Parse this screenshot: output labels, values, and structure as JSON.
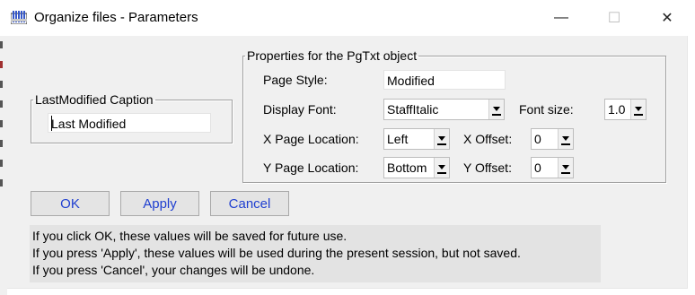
{
  "window": {
    "title": "Organize files - Parameters",
    "min_glyph": "—",
    "max_glyph": "☐",
    "close_glyph": "✕"
  },
  "caption_group": {
    "legend": "LastModified Caption",
    "value": "Last Modified"
  },
  "props_group": {
    "legend": "Properties for the PgTxt object",
    "page_style_label": "Page Style:",
    "page_style_value": "Modified",
    "display_font_label": "Display Font:",
    "display_font_value": "StaffItalic",
    "font_size_label": "Font size:",
    "font_size_value": "1.0",
    "x_loc_label": "X Page Location:",
    "x_loc_value": "Left",
    "x_offset_label": "X Offset:",
    "x_offset_value": "0",
    "y_loc_label": "Y Page Location:",
    "y_loc_value": "Bottom",
    "y_offset_label": "Y Offset:",
    "y_offset_value": "0"
  },
  "buttons": {
    "ok": "OK",
    "apply": "Apply",
    "cancel": "Cancel"
  },
  "info_lines": [
    "If you click OK, these values will be saved for future use.",
    "If you press 'Apply', these values will be used during the present session, but not saved.",
    "If you press 'Cancel', your changes will be undone."
  ],
  "colors": {
    "button_text": "#1f3fd0",
    "dialog_bg": "#f0f0f0",
    "info_bg": "#e3e3e3"
  },
  "icons": [
    "app-icon",
    "minimize-icon",
    "maximize-icon",
    "close-icon",
    "dropdown-arrow-icon"
  ]
}
